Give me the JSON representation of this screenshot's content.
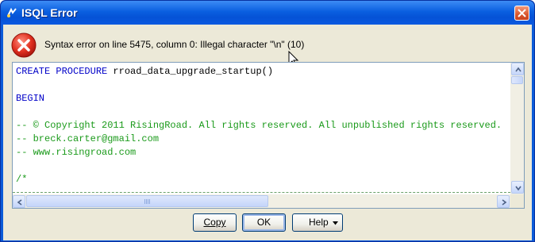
{
  "window": {
    "title": "ISQL Error"
  },
  "error": {
    "message": "Syntax error on line 5475, column 0: Illegal character \"\\n\" (10)"
  },
  "editor": {
    "lines": [
      {
        "kind": "kw",
        "text": "CREATE PROCEDURE",
        "rest": " rroad_data_upgrade_startup()"
      },
      {
        "kind": "kw",
        "text": "BEGIN",
        "rest": ""
      },
      {
        "kind": "cm",
        "text": "-- © Copyright 2011 RisingRoad. All rights reserved. All unpublished rights reserved.",
        "rest": ""
      },
      {
        "kind": "cm",
        "text": "-- breck.carter@gmail.com",
        "rest": ""
      },
      {
        "kind": "cm",
        "text": "-- www.risingroad.com",
        "rest": ""
      },
      {
        "kind": "cm",
        "text": "/*",
        "rest": ""
      }
    ]
  },
  "buttons": {
    "copy": "Copy",
    "ok": "OK",
    "help": "Help"
  },
  "icons": {
    "app": "sql-app-icon",
    "error": "error-icon",
    "close": "close-icon",
    "cursor": "mouse-cursor-icon",
    "dropdown": "dropdown-arrow-icon"
  },
  "colors": {
    "titlebar": "#0a5fe0",
    "dialog_bg": "#ece9d8",
    "keyword": "#0000c8",
    "comment": "#1a9a1a",
    "error_red": "#d8281f"
  }
}
